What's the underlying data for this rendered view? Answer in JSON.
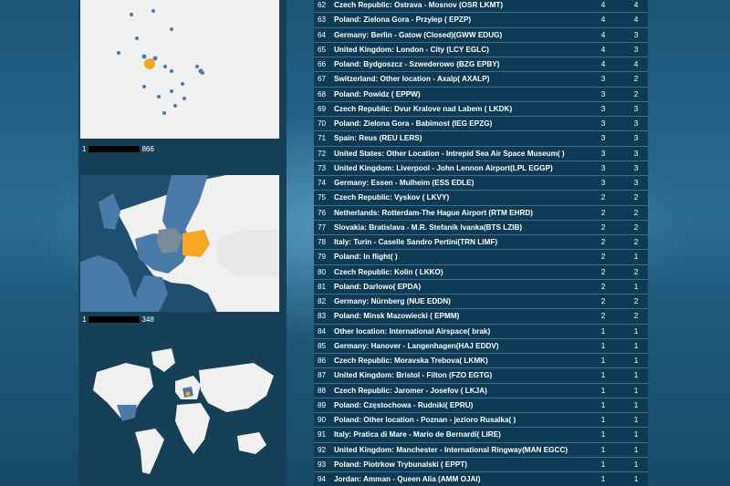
{
  "colors": {
    "background": "#184a67",
    "table_bg": "#0f3a53",
    "highlight": "#f5a623",
    "map_region": "#4a7ba8",
    "map_land": "#f0f0f0",
    "map_water": "#123e58"
  },
  "maps": {
    "poland_scale": {
      "min": "1",
      "max": "866"
    },
    "europe_scale": {
      "min": "1",
      "max": "348"
    }
  },
  "table": {
    "rows": [
      {
        "num": "62",
        "location": "Czech Republic: Ostrava - Mosnov (OSR LKMT)",
        "v1": "4",
        "v2": "4"
      },
      {
        "num": "63",
        "location": "Poland: Zielona Gora - Przylep ( EPZP)",
        "v1": "4",
        "v2": "4"
      },
      {
        "num": "64",
        "location": "Germany: Berlin - Gatow (Closed)(GWW EDUG)",
        "v1": "4",
        "v2": "3"
      },
      {
        "num": "65",
        "location": "United Kingdom: London - City (LCY EGLC)",
        "v1": "4",
        "v2": "3"
      },
      {
        "num": "66",
        "location": "Poland: Bydgoszcz - Szwederowo (BZG EPBY)",
        "v1": "4",
        "v2": "4"
      },
      {
        "num": "67",
        "location": "Switzerland: Other location - Axalp( AXALP)",
        "v1": "3",
        "v2": "2"
      },
      {
        "num": "68",
        "location": "Poland: Powidz ( EPPW)",
        "v1": "3",
        "v2": "2"
      },
      {
        "num": "69",
        "location": "Czech Republic: Dvur Kralove nad Labem ( LKDK)",
        "v1": "3",
        "v2": "3"
      },
      {
        "num": "70",
        "location": "Poland: Zielona Gora - Babimost (IEG EPZG)",
        "v1": "3",
        "v2": "3"
      },
      {
        "num": "71",
        "location": "Spain: Reus (REU LERS)",
        "v1": "3",
        "v2": "3"
      },
      {
        "num": "72",
        "location": "United States: Other Location - Intrepid Sea Air Space Museum( )",
        "v1": "3",
        "v2": "3"
      },
      {
        "num": "73",
        "location": "United Kingdom: Liverpool - John Lennon Airport(LPL EGGP)",
        "v1": "3",
        "v2": "3"
      },
      {
        "num": "74",
        "location": "Germany: Essen - Mulheim (ESS EDLE)",
        "v1": "3",
        "v2": "3"
      },
      {
        "num": "75",
        "location": "Czech Republic: Vyskov ( LKVY)",
        "v1": "2",
        "v2": "2"
      },
      {
        "num": "76",
        "location": "Netherlands: Rotterdam-The Hague Airport (RTM EHRD)",
        "v1": "2",
        "v2": "2"
      },
      {
        "num": "77",
        "location": "Slovakia: Bratislava - M.R. Stefanik Ivanka(BTS LZIB)",
        "v1": "2",
        "v2": "2"
      },
      {
        "num": "78",
        "location": "Italy: Turin - Caselle Sandro Pertini(TRN LIMF)",
        "v1": "2",
        "v2": "2"
      },
      {
        "num": "79",
        "location": "Poland: In flight( )",
        "v1": "2",
        "v2": "1"
      },
      {
        "num": "80",
        "location": "Czech Republic: Kolin ( LKKO)",
        "v1": "2",
        "v2": "2"
      },
      {
        "num": "81",
        "location": "Poland: Darlowo( EPDA)",
        "v1": "2",
        "v2": "1"
      },
      {
        "num": "82",
        "location": "Germany: Nürnberg (NUE EDDN)",
        "v1": "2",
        "v2": "2"
      },
      {
        "num": "83",
        "location": "Poland: Minsk Mazowiecki ( EPMM)",
        "v1": "2",
        "v2": "2"
      },
      {
        "num": "84",
        "location": "Other location: International Airspace( brak)",
        "v1": "1",
        "v2": "1"
      },
      {
        "num": "85",
        "location": "Germany: Hanover - Langenhagen(HAJ EDDV)",
        "v1": "1",
        "v2": "1"
      },
      {
        "num": "86",
        "location": "Czech Republic: Moravska Trebova( LKMK)",
        "v1": "1",
        "v2": "1"
      },
      {
        "num": "87",
        "location": "United Kingdom: Bristol - Filton (FZO EGTG)",
        "v1": "1",
        "v2": "1"
      },
      {
        "num": "88",
        "location": "Czech Republic: Jaromer - Josefov ( LKJA)",
        "v1": "1",
        "v2": "1"
      },
      {
        "num": "89",
        "location": "Poland: Częstochowa - Rudniki( EPRU)",
        "v1": "1",
        "v2": "1"
      },
      {
        "num": "90",
        "location": "Poland: Other location - Poznan - jezioro Rusalka( )",
        "v1": "1",
        "v2": "1"
      },
      {
        "num": "91",
        "location": "Italy: Pratica di Mare - Mario de Bernardi( LIRE)",
        "v1": "1",
        "v2": "1"
      },
      {
        "num": "92",
        "location": "United Kingdom: Manchester - International Ringway(MAN EGCC)",
        "v1": "1",
        "v2": "1"
      },
      {
        "num": "93",
        "location": "Poland: Piotrkow Trybunalski ( EPPT)",
        "v1": "1",
        "v2": "1"
      },
      {
        "num": "94",
        "location": "Jordan: Amman - Queen Alia (AMM OJAI)",
        "v1": "1",
        "v2": "1"
      }
    ]
  }
}
